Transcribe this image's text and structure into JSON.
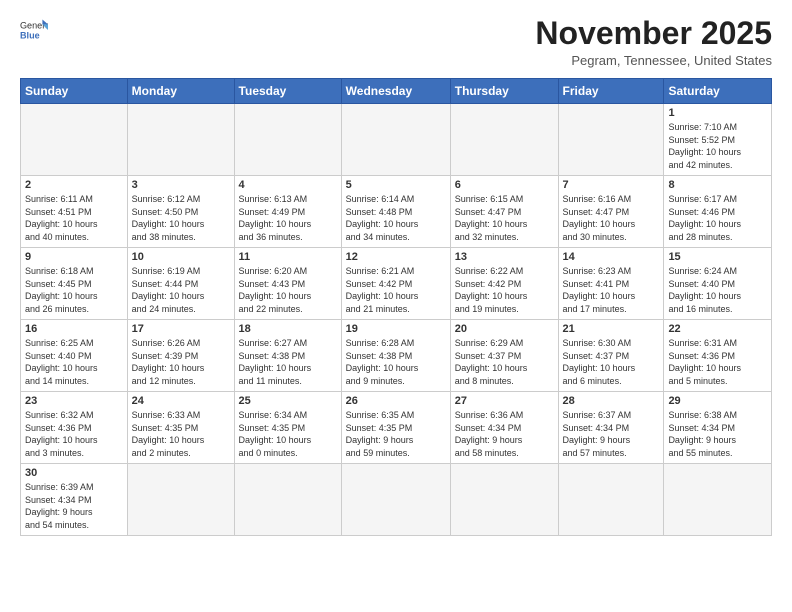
{
  "header": {
    "logo_general": "General",
    "logo_blue": "Blue",
    "month_title": "November 2025",
    "subtitle": "Pegram, Tennessee, United States"
  },
  "weekdays": [
    "Sunday",
    "Monday",
    "Tuesday",
    "Wednesday",
    "Thursday",
    "Friday",
    "Saturday"
  ],
  "weeks": [
    [
      {
        "day": "",
        "info": ""
      },
      {
        "day": "",
        "info": ""
      },
      {
        "day": "",
        "info": ""
      },
      {
        "day": "",
        "info": ""
      },
      {
        "day": "",
        "info": ""
      },
      {
        "day": "",
        "info": ""
      },
      {
        "day": "1",
        "info": "Sunrise: 7:10 AM\nSunset: 5:52 PM\nDaylight: 10 hours\nand 42 minutes."
      }
    ],
    [
      {
        "day": "2",
        "info": "Sunrise: 6:11 AM\nSunset: 4:51 PM\nDaylight: 10 hours\nand 40 minutes."
      },
      {
        "day": "3",
        "info": "Sunrise: 6:12 AM\nSunset: 4:50 PM\nDaylight: 10 hours\nand 38 minutes."
      },
      {
        "day": "4",
        "info": "Sunrise: 6:13 AM\nSunset: 4:49 PM\nDaylight: 10 hours\nand 36 minutes."
      },
      {
        "day": "5",
        "info": "Sunrise: 6:14 AM\nSunset: 4:48 PM\nDaylight: 10 hours\nand 34 minutes."
      },
      {
        "day": "6",
        "info": "Sunrise: 6:15 AM\nSunset: 4:47 PM\nDaylight: 10 hours\nand 32 minutes."
      },
      {
        "day": "7",
        "info": "Sunrise: 6:16 AM\nSunset: 4:47 PM\nDaylight: 10 hours\nand 30 minutes."
      },
      {
        "day": "8",
        "info": "Sunrise: 6:17 AM\nSunset: 4:46 PM\nDaylight: 10 hours\nand 28 minutes."
      }
    ],
    [
      {
        "day": "9",
        "info": "Sunrise: 6:18 AM\nSunset: 4:45 PM\nDaylight: 10 hours\nand 26 minutes."
      },
      {
        "day": "10",
        "info": "Sunrise: 6:19 AM\nSunset: 4:44 PM\nDaylight: 10 hours\nand 24 minutes."
      },
      {
        "day": "11",
        "info": "Sunrise: 6:20 AM\nSunset: 4:43 PM\nDaylight: 10 hours\nand 22 minutes."
      },
      {
        "day": "12",
        "info": "Sunrise: 6:21 AM\nSunset: 4:42 PM\nDaylight: 10 hours\nand 21 minutes."
      },
      {
        "day": "13",
        "info": "Sunrise: 6:22 AM\nSunset: 4:42 PM\nDaylight: 10 hours\nand 19 minutes."
      },
      {
        "day": "14",
        "info": "Sunrise: 6:23 AM\nSunset: 4:41 PM\nDaylight: 10 hours\nand 17 minutes."
      },
      {
        "day": "15",
        "info": "Sunrise: 6:24 AM\nSunset: 4:40 PM\nDaylight: 10 hours\nand 16 minutes."
      }
    ],
    [
      {
        "day": "16",
        "info": "Sunrise: 6:25 AM\nSunset: 4:40 PM\nDaylight: 10 hours\nand 14 minutes."
      },
      {
        "day": "17",
        "info": "Sunrise: 6:26 AM\nSunset: 4:39 PM\nDaylight: 10 hours\nand 12 minutes."
      },
      {
        "day": "18",
        "info": "Sunrise: 6:27 AM\nSunset: 4:38 PM\nDaylight: 10 hours\nand 11 minutes."
      },
      {
        "day": "19",
        "info": "Sunrise: 6:28 AM\nSunset: 4:38 PM\nDaylight: 10 hours\nand 9 minutes."
      },
      {
        "day": "20",
        "info": "Sunrise: 6:29 AM\nSunset: 4:37 PM\nDaylight: 10 hours\nand 8 minutes."
      },
      {
        "day": "21",
        "info": "Sunrise: 6:30 AM\nSunset: 4:37 PM\nDaylight: 10 hours\nand 6 minutes."
      },
      {
        "day": "22",
        "info": "Sunrise: 6:31 AM\nSunset: 4:36 PM\nDaylight: 10 hours\nand 5 minutes."
      }
    ],
    [
      {
        "day": "23",
        "info": "Sunrise: 6:32 AM\nSunset: 4:36 PM\nDaylight: 10 hours\nand 3 minutes."
      },
      {
        "day": "24",
        "info": "Sunrise: 6:33 AM\nSunset: 4:35 PM\nDaylight: 10 hours\nand 2 minutes."
      },
      {
        "day": "25",
        "info": "Sunrise: 6:34 AM\nSunset: 4:35 PM\nDaylight: 10 hours\nand 0 minutes."
      },
      {
        "day": "26",
        "info": "Sunrise: 6:35 AM\nSunset: 4:35 PM\nDaylight: 9 hours\nand 59 minutes."
      },
      {
        "day": "27",
        "info": "Sunrise: 6:36 AM\nSunset: 4:34 PM\nDaylight: 9 hours\nand 58 minutes."
      },
      {
        "day": "28",
        "info": "Sunrise: 6:37 AM\nSunset: 4:34 PM\nDaylight: 9 hours\nand 57 minutes."
      },
      {
        "day": "29",
        "info": "Sunrise: 6:38 AM\nSunset: 4:34 PM\nDaylight: 9 hours\nand 55 minutes."
      }
    ],
    [
      {
        "day": "30",
        "info": "Sunrise: 6:39 AM\nSunset: 4:34 PM\nDaylight: 9 hours\nand 54 minutes."
      },
      {
        "day": "",
        "info": ""
      },
      {
        "day": "",
        "info": ""
      },
      {
        "day": "",
        "info": ""
      },
      {
        "day": "",
        "info": ""
      },
      {
        "day": "",
        "info": ""
      },
      {
        "day": "",
        "info": ""
      }
    ]
  ]
}
